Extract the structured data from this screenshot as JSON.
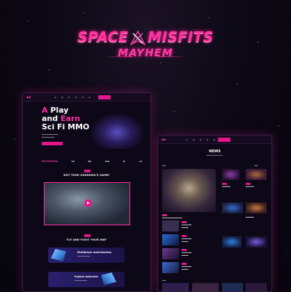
{
  "logo": {
    "title_left": "SPACE",
    "title_right": "MISFITS",
    "subtitle": "MAYHEM",
    "emblem_icon": "crossed-blades-emblem-icon"
  },
  "page1": {
    "hero": {
      "line1_pink": "A",
      "line1_white": "Play",
      "line2_white": "and",
      "line2_pink": "Earn",
      "line3": "Sci Fi MMO"
    },
    "section_1_title": "NOT YOUR GRANDMA'S GAME!",
    "section_2_title": "FLY AND FIGHT YOUR WAY",
    "features": [
      {
        "title": "Multiplayer matchmaking"
      },
      {
        "title": "Explore Asteroids"
      }
    ],
    "partners_label": "Our Partners"
  },
  "page2": {
    "title": "NEWS"
  },
  "colors": {
    "accent": "#ff2fa0",
    "button": "#e3178b",
    "background": "#0a0612",
    "panel": "#0d0818"
  }
}
